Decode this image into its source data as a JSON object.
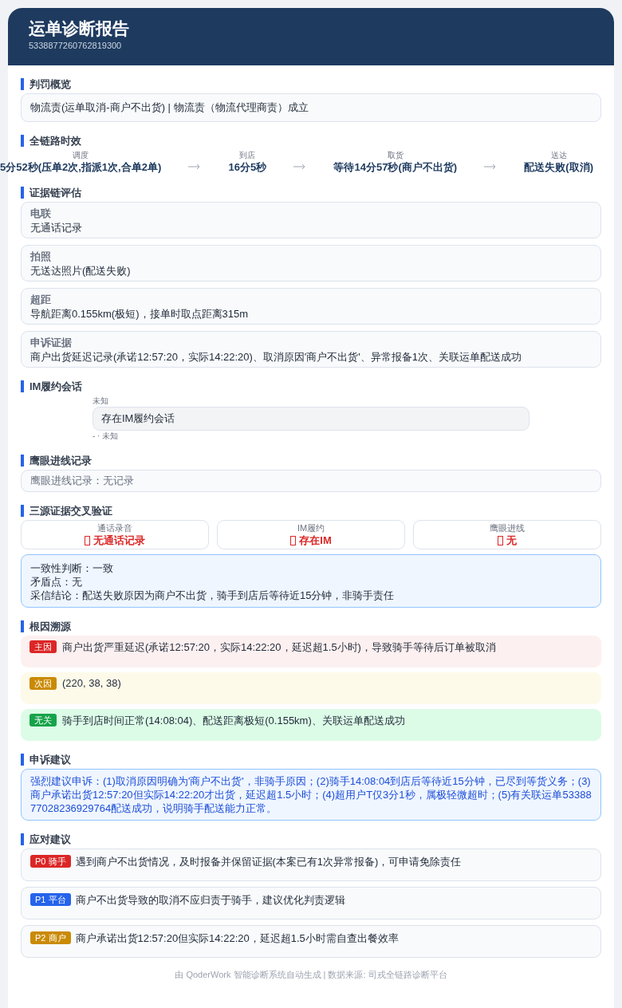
{
  "header": {
    "title": "运单诊断报告",
    "order_id": "5338877260762819300"
  },
  "penalty": {
    "title": "判罚概览",
    "text": "物流责(运单取消-商户不出货)  |  物流责（物流代理商责）成立"
  },
  "timeline": {
    "title": "全链路时效",
    "steps": [
      {
        "label": "调度",
        "value": "5分52秒(压单2次,指派1次,合单2单)"
      },
      {
        "label": "到店",
        "value": "16分5秒"
      },
      {
        "label": "取货",
        "value": "等待14分57秒(商户不出货)"
      },
      {
        "label": "送达",
        "value": "配送失败(取消)"
      }
    ]
  },
  "evidence": {
    "title": "证据链评估",
    "items": [
      {
        "label": "电联",
        "text": "无通话记录"
      },
      {
        "label": "拍照",
        "text": "无送达照片(配送失败)"
      },
      {
        "label": "超距",
        "text": "导航距离0.155km(极短)，接单时取点距离315m"
      },
      {
        "label": "申诉证据",
        "text": "商户出货延迟记录(承诺12:57:20，实际14:22:20)、取消原因'商户不出货'、异常报备1次、关联运单配送成功"
      }
    ]
  },
  "im": {
    "title": "IM履约会话",
    "top_note": "未知",
    "text": "存在IM履约会话",
    "bottom_note": "-  · 未知"
  },
  "eagle": {
    "title": "鹰眼进线记录",
    "text": "鹰眼进线记录：无记录"
  },
  "cross": {
    "title": "三源证据交叉验证",
    "sources": [
      {
        "label": "通话录音",
        "value": "无通话记录"
      },
      {
        "label": "IM履约",
        "value": "存在IM"
      },
      {
        "label": "鹰眼进线",
        "value": "无"
      }
    ],
    "summary": [
      "一致性判断：一致",
      "矛盾点：无",
      "采信结论：配送失败原因为商户不出货，骑手到店后等待近15分钟，非骑手责任"
    ]
  },
  "root_cause": {
    "title": "根因溯源",
    "items": [
      {
        "tag": "主因",
        "kind": "primary",
        "text": "商户出货严重延迟(承诺12:57:20，实际14:22:20，延迟超1.5小时)，导致骑手等待后订单被取消"
      },
      {
        "tag": "次因",
        "kind": "secondary",
        "text": "(220, 38, 38)"
      },
      {
        "tag": "无关",
        "kind": "unrelated",
        "text": "骑手到店时间正常(14:08:04)、配送距离极短(0.155km)、关联运单配送成功"
      }
    ]
  },
  "appeal": {
    "title": "申诉建议",
    "text": "强烈建议申诉：(1)取消原因明确为'商户不出货'，非骑手原因；(2)骑手14:08:04到店后等待近15分钟，已尽到等货义务；(3)商户承诺出货12:57:20但实际14:22:20才出货，延迟超1.5小时；(4)超用户T仅3分1秒，属极轻微超时；(5)有关联运单5338877028236929764配送成功，说明骑手配送能力正常。"
  },
  "actions": {
    "title": "应对建议",
    "items": [
      {
        "tag": "P0 骑手",
        "kind": "p0",
        "text": "遇到商户不出货情况，及时报备并保留证据(本案已有1次异常报备)，可申请免除责任"
      },
      {
        "tag": "P1 平台",
        "kind": "p1",
        "text": "商户不出货导致的取消不应归责于骑手，建议优化判责逻辑"
      },
      {
        "tag": "P2 商户",
        "kind": "p2",
        "text": "商户承诺出货12:57:20但实际14:22:20，延迟超1.5小时需自查出餐效率"
      }
    ]
  },
  "footer": "由 QoderWork 智能诊断系统自动生成 | 数据来源: 司戎全链路诊断平台"
}
